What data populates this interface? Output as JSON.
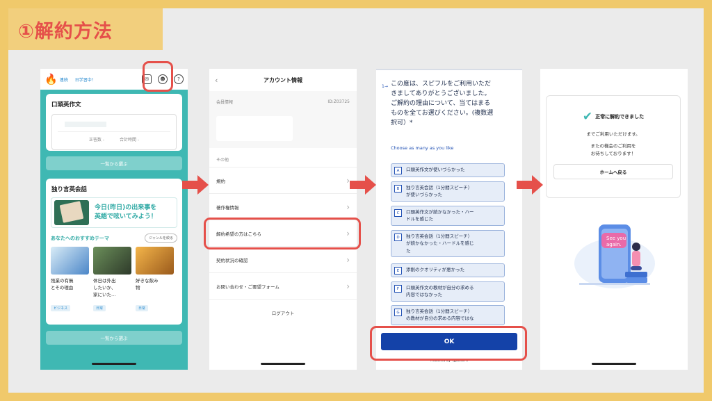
{
  "title": "①解約方法",
  "colors": {
    "accent_red": "#e5504a",
    "teal": "#3fb8b3",
    "brand_blue": "#1442a8",
    "frame": "#f0c96b"
  },
  "screen1": {
    "streak_label": "連続",
    "status": "日学習中！",
    "icons": [
      "mail-icon",
      "account-icon",
      "help-icon"
    ],
    "card1_title": "口頭英作文",
    "stat_correct": "正答数 -",
    "stat_time": "合計時間 -",
    "list_button": "一覧から選ぶ",
    "card2_title": "独り言英会話",
    "banner_line1": "今日(昨日)の出来事を",
    "banner_line2": "英語で呟いてみよう！",
    "rec_title": "あなたへのおすすめテーマ",
    "genre_button": "ジャンルを絞る",
    "themes": [
      {
        "line1": "残業の有無",
        "line2": "とその理由",
        "line3": "",
        "tag": "ビジネス"
      },
      {
        "line1": "休日は外出",
        "line2": "したいか、",
        "line3": "家にいた…",
        "tag": "日常"
      },
      {
        "line1": "好きな飲み",
        "line2": "物",
        "line3": "",
        "tag": "日常"
      }
    ],
    "list_button2": "一覧から選ぶ"
  },
  "screen2": {
    "nav_title": "アカウント情報",
    "member_label": "会員情報",
    "member_id": "ID:Z03725",
    "section_other": "その他",
    "rows": [
      "規約",
      "著作権情報",
      "解約希望の方はこちら",
      "契約状況の確認",
      "お問い合わせ・ご要望フォーム"
    ],
    "logout": "ログアウト"
  },
  "screen3": {
    "question_number": "1→",
    "question_line1": "この度は、スピフルをご利用いただ",
    "question_line2": "きましてありがとうございました。",
    "question_line3": "ご解約の理由について、当てはまる",
    "question_line4": "ものを全てお選びください。(複数選",
    "question_line5": "択可）*",
    "choose_hint": "Choose as many as you like",
    "options": [
      {
        "key": "A",
        "line1": "口頭英作文が使いづらかった",
        "line2": "",
        "line3": ""
      },
      {
        "key": "B",
        "line1": "独り言英会話（1分間スピーチ）",
        "line2": "が使いづらかった",
        "line3": ""
      },
      {
        "key": "C",
        "line1": "口頭英作文が続かなかった・ハー",
        "line2": "ドルを感じた",
        "line3": ""
      },
      {
        "key": "D",
        "line1": "独り言英会話（1分間スピーチ）",
        "line2": "が続かなかった・ハードルを感じ",
        "line3": "た"
      },
      {
        "key": "E",
        "line1": "添削のクオリティが悪かった",
        "line2": "",
        "line3": ""
      },
      {
        "key": "F",
        "line1": "口頭英作文の教材が自分の求める",
        "line2": "内容ではなかった",
        "line3": ""
      },
      {
        "key": "G",
        "line1": "独り言英会話（1分間スピーチ）",
        "line2": "の教材が自分の求める内容ではな",
        "line3": ""
      }
    ],
    "ok_button": "OK",
    "powered_by": "Powered by Typeform"
  },
  "screen4": {
    "done_title": "正常に解約できました",
    "line1": "までご利用いただけます。",
    "line2": "またの機会のご利用を",
    "line3": "お待ちしております！",
    "home_button": "ホームへ戻る",
    "bubble_text1": "See you",
    "bubble_text2": "again."
  }
}
